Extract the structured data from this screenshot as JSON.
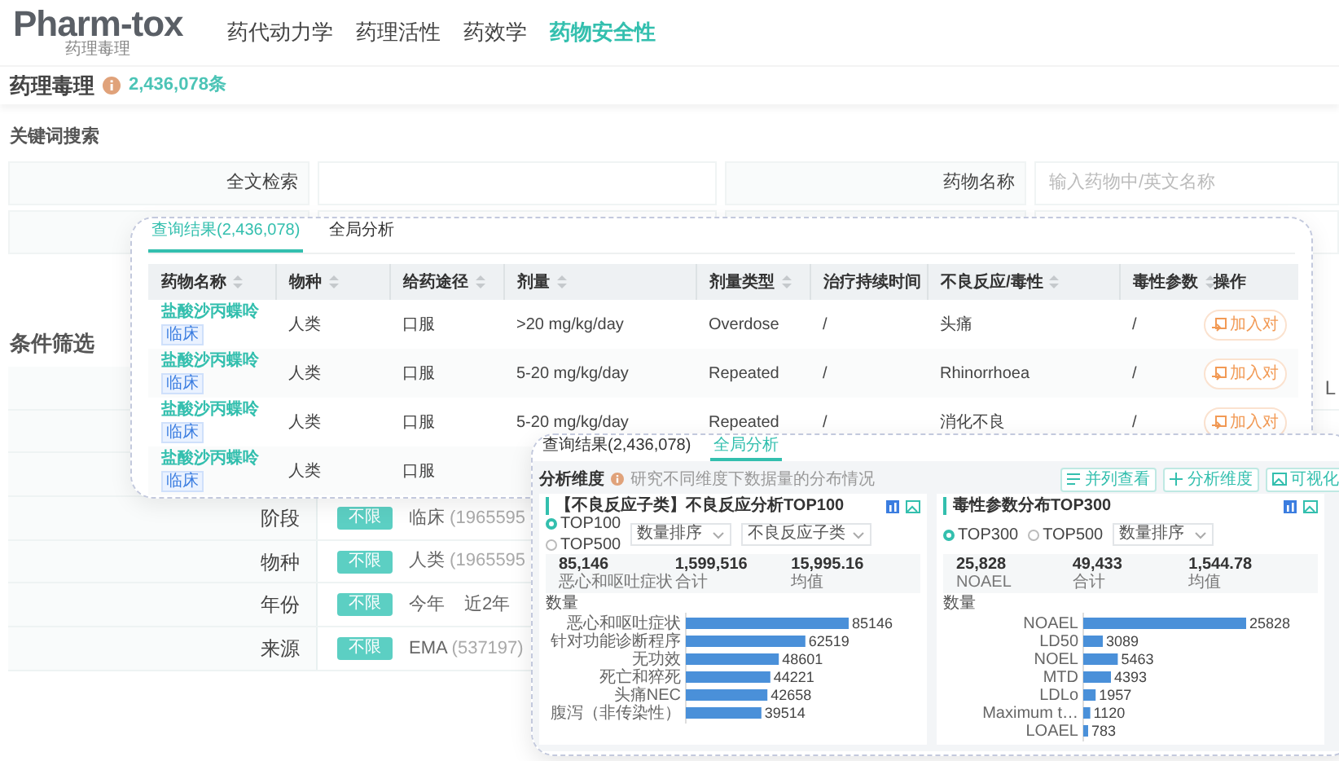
{
  "logo": {
    "name": "Pharm-tox",
    "subtitle": "药理毒理"
  },
  "nav": [
    {
      "label": "药代动力学",
      "selected": false
    },
    {
      "label": "药理活性",
      "selected": false
    },
    {
      "label": "药效学",
      "selected": false
    },
    {
      "label": "药物安全性",
      "selected": true
    }
  ],
  "page_title": {
    "title": "药理毒理",
    "count": "2,436,078条"
  },
  "keyword_search": {
    "title": "关键词搜索",
    "fields": [
      {
        "label": "全文检索"
      },
      {
        "label": "药物名称",
        "placeholder": "输入药物中/英文名称"
      }
    ]
  },
  "filters": {
    "title": "条件筛选",
    "edge_text": "L",
    "rows": [
      {
        "label": "阶段",
        "all": {
          "label": "不限",
          "selected": true
        },
        "options": [
          {
            "label": "临床",
            "count": "(1965595"
          }
        ]
      },
      {
        "label": "物种",
        "all": {
          "label": "不限",
          "selected": true
        },
        "options": [
          {
            "label": "人类",
            "count": "(1965595"
          }
        ]
      },
      {
        "label": "年份",
        "all": {
          "label": "不限",
          "selected": true
        },
        "options": [
          {
            "label": "今年"
          },
          {
            "label": "近2年"
          }
        ]
      },
      {
        "label": "来源",
        "all": {
          "label": "不限",
          "selected": true
        },
        "options": [
          {
            "label": "EMA",
            "count": "(537197)"
          }
        ]
      }
    ]
  },
  "results_panel": {
    "tabs": [
      {
        "label": "查询结果(2,436,078)",
        "selected": true
      },
      {
        "label": "全局分析",
        "selected": false
      }
    ],
    "columns": [
      {
        "label": "药物名称",
        "sortable": true,
        "kind": "link"
      },
      {
        "label": "物种",
        "sortable": true,
        "kind": "text"
      },
      {
        "label": "给药途径",
        "sortable": true,
        "kind": "text"
      },
      {
        "label": "剂量",
        "sortable": true,
        "kind": "text"
      },
      {
        "label": "剂量类型",
        "sortable": true,
        "kind": "text"
      },
      {
        "label": "治疗持续时间",
        "sortable": false,
        "kind": "text"
      },
      {
        "label": "不良反应/毒性",
        "sortable": true,
        "kind": "text"
      },
      {
        "label": "毒性参数",
        "sortable": true,
        "kind": "text"
      },
      {
        "label": "操作",
        "sortable": false,
        "kind": "action"
      }
    ],
    "rows": [
      {
        "tag": "临床",
        "cells": [
          "盐酸沙丙蝶呤",
          "人类",
          "口服",
          ">20 mg/kg/day",
          "Overdose",
          "/",
          "头痛",
          "/",
          "加入对"
        ]
      },
      {
        "tag": "临床",
        "cells": [
          "盐酸沙丙蝶呤",
          "人类",
          "口服",
          "5-20 mg/kg/day",
          "Repeated",
          "/",
          "Rhinorrhoea",
          "/",
          "加入对"
        ]
      },
      {
        "tag": "临床",
        "cells": [
          "盐酸沙丙蝶呤",
          "人类",
          "口服",
          "5-20 mg/kg/day",
          "Repeated",
          "/",
          "消化不良",
          "/",
          "加入对"
        ]
      },
      {
        "tag": "临床",
        "cells": [
          "盐酸沙丙蝶呤",
          "人类",
          "口服"
        ]
      }
    ]
  },
  "analysis_panel": {
    "tabs": [
      {
        "label": "查询结果(2,436,078)",
        "selected": false
      },
      {
        "label": "全局分析",
        "selected": true
      }
    ],
    "dimension_label": "分析维度",
    "hint": "研究不同维度下数据量的分布情况",
    "buttons": [
      {
        "label": "并列查看",
        "kind": "list"
      },
      {
        "label": "分析维度",
        "kind": "plus"
      },
      {
        "label": "可视化",
        "kind": "image"
      }
    ],
    "charts": [
      {
        "title": "【不良反应子类】不良反应分析TOP100",
        "stacked_options": true,
        "options": [
          {
            "label": "TOP100",
            "selected": true
          },
          {
            "label": "TOP500",
            "selected": false
          }
        ],
        "selects": [
          {
            "value": "数量排序"
          },
          {
            "value": "不良反应子类"
          }
        ],
        "stats": [
          {
            "value": "85,146",
            "label": "恶心和呕吐症状"
          },
          {
            "value": "1,599,516",
            "label": "合计"
          },
          {
            "value": "15,995.16",
            "label": "均值"
          }
        ],
        "chart_data": {
          "type": "bar",
          "orientation": "horizontal",
          "data_labels": true,
          "categories": [
            "恶心和呕吐症状",
            "针对功能诊断程序",
            "无功效",
            "死亡和猝死",
            "头痛NEC",
            "腹泻（非传染性）"
          ],
          "series": [
            {
              "name": "数量",
              "color": "#4a90d9",
              "values": [
                85146,
                62519,
                48601,
                44221,
                42658,
                39514
              ]
            }
          ]
        }
      },
      {
        "title": "毒性参数分布TOP300",
        "stacked_options": false,
        "options": [
          {
            "label": "TOP300",
            "selected": true
          },
          {
            "label": "TOP500",
            "selected": false
          }
        ],
        "selects": [
          {
            "value": "数量排序"
          }
        ],
        "stats": [
          {
            "value": "25,828",
            "label": "NOAEL"
          },
          {
            "value": "49,433",
            "label": "合计"
          },
          {
            "value": "1,544.78",
            "label": "均值"
          }
        ],
        "chart_data": {
          "type": "bar",
          "orientation": "horizontal",
          "data_labels": true,
          "categories": [
            "NOAEL",
            "LD50",
            "NOEL",
            "MTD",
            "LDLo",
            "Maximum t…",
            "LOAEL"
          ],
          "series": [
            {
              "name": "数量",
              "color": "#4a90d9",
              "values": [
                25828,
                3089,
                5463,
                4393,
                1957,
                1120,
                783
              ]
            }
          ]
        }
      }
    ]
  }
}
